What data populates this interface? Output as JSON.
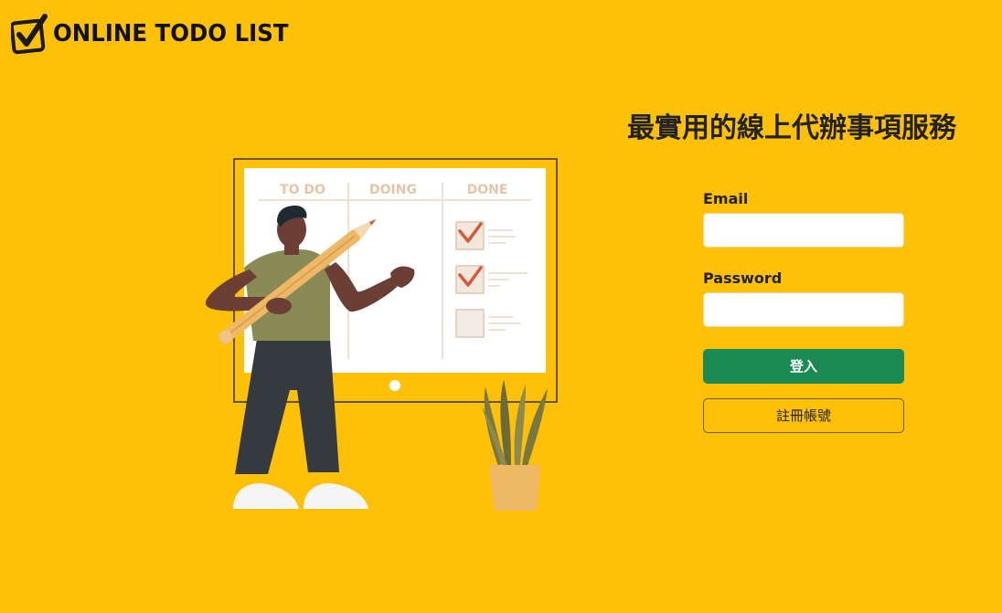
{
  "app": {
    "name": "ONLINE TODO LIST"
  },
  "hero": {
    "title": "最實用的線上代辦事項服務"
  },
  "board": {
    "columns": [
      "TO DO",
      "DOING",
      "DONE"
    ]
  },
  "form": {
    "email_label": "Email",
    "email_value": "",
    "email_placeholder": "",
    "password_label": "Password",
    "password_value": "",
    "password_placeholder": "",
    "login_label": "登入",
    "register_label": "註冊帳號"
  },
  "colors": {
    "background": "#FFC107",
    "primary_button": "#1B8A55",
    "checkmark": "#D05A3C"
  },
  "icons": {
    "logo": "checkbox-check-icon"
  }
}
